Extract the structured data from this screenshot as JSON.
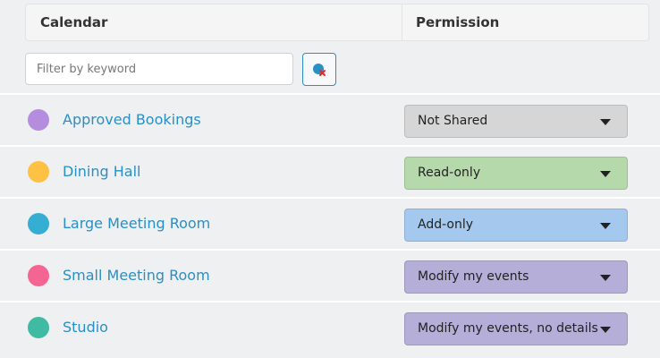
{
  "header": {
    "calendar_label": "Calendar",
    "permission_label": "Permission"
  },
  "filter": {
    "placeholder": "Filter by keyword",
    "value": ""
  },
  "clear_button_icon": "clear-filter-icon",
  "rows": [
    {
      "name": "Approved Bookings",
      "color": "#b48ddf",
      "permission": "Not Shared",
      "perm_bg": "#d6d6d6"
    },
    {
      "name": "Dining Hall",
      "color": "#fdc244",
      "permission": "Read-only",
      "perm_bg": "#b6d9ab"
    },
    {
      "name": "Large Meeting Room",
      "color": "#36add3",
      "permission": "Add-only",
      "perm_bg": "#a5c8ef"
    },
    {
      "name": "Small Meeting Room",
      "color": "#f46593",
      "permission": "Modify my events",
      "perm_bg": "#b5aed8"
    },
    {
      "name": "Studio",
      "color": "#3fbba4",
      "permission": "Modify my events, no details",
      "perm_bg": "#b5aed8"
    }
  ]
}
